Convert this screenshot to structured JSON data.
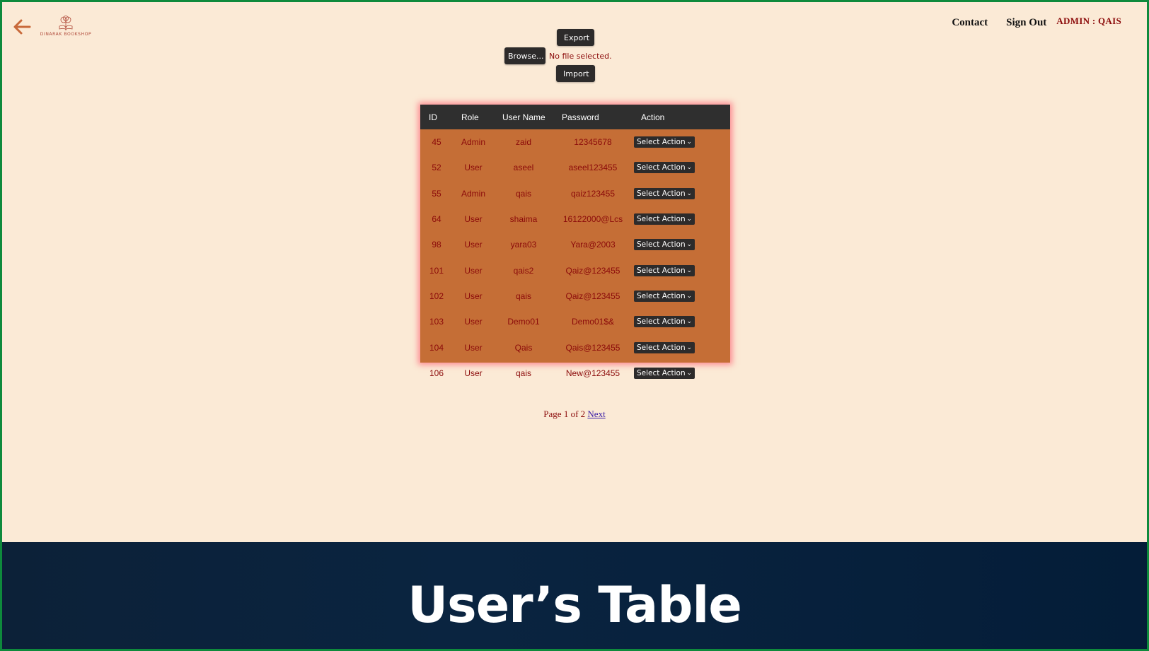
{
  "header": {
    "logo_text": "DINARAK BOOKSHOP",
    "nav": {
      "contact": "Contact",
      "sign_out": "Sign Out",
      "admin_label": "ADMIN : QAIS"
    }
  },
  "toolbar": {
    "export_label": "Export",
    "browse_label": "Browse...",
    "file_status": "No file selected.",
    "import_label": "Import"
  },
  "table": {
    "columns": [
      "ID",
      "Role",
      "User Name",
      "Password",
      "Action"
    ],
    "rows": [
      {
        "id": "45",
        "role": "Admin",
        "username": "zaid",
        "password": "12345678",
        "action": "Select Action"
      },
      {
        "id": "52",
        "role": "User",
        "username": "aseel",
        "password": "aseel123455",
        "action": "Select Action"
      },
      {
        "id": "55",
        "role": "Admin",
        "username": "qais",
        "password": "qaiz123455",
        "action": "Select Action"
      },
      {
        "id": "64",
        "role": "User",
        "username": "shaima",
        "password": "16122000@Lcs",
        "action": "Select Action"
      },
      {
        "id": "98",
        "role": "User",
        "username": "yara03",
        "password": "Yara@2003",
        "action": "Select Action"
      },
      {
        "id": "101",
        "role": "User",
        "username": "qais2",
        "password": "Qaiz@123455",
        "action": "Select Action"
      },
      {
        "id": "102",
        "role": "User",
        "username": "qais",
        "password": "Qaiz@123455",
        "action": "Select Action"
      },
      {
        "id": "103",
        "role": "User",
        "username": "Demo01",
        "password": "Demo01$&",
        "action": "Select Action"
      },
      {
        "id": "104",
        "role": "User",
        "username": "Qais",
        "password": "Qais@123455",
        "action": "Select Action"
      },
      {
        "id": "106",
        "role": "User",
        "username": "qais",
        "password": "New@123455",
        "action": "Select Action"
      }
    ]
  },
  "pagination": {
    "text": "Page 1 of 2",
    "next_label": "Next"
  },
  "banner": {
    "title": "User’s Table"
  },
  "colors": {
    "page_bg": "#fbead6",
    "table_bg": "#c56e36",
    "table_header_bg": "#2f2f2f",
    "text_accent": "#8b0a0a",
    "banner_bg": "#0a2440"
  }
}
